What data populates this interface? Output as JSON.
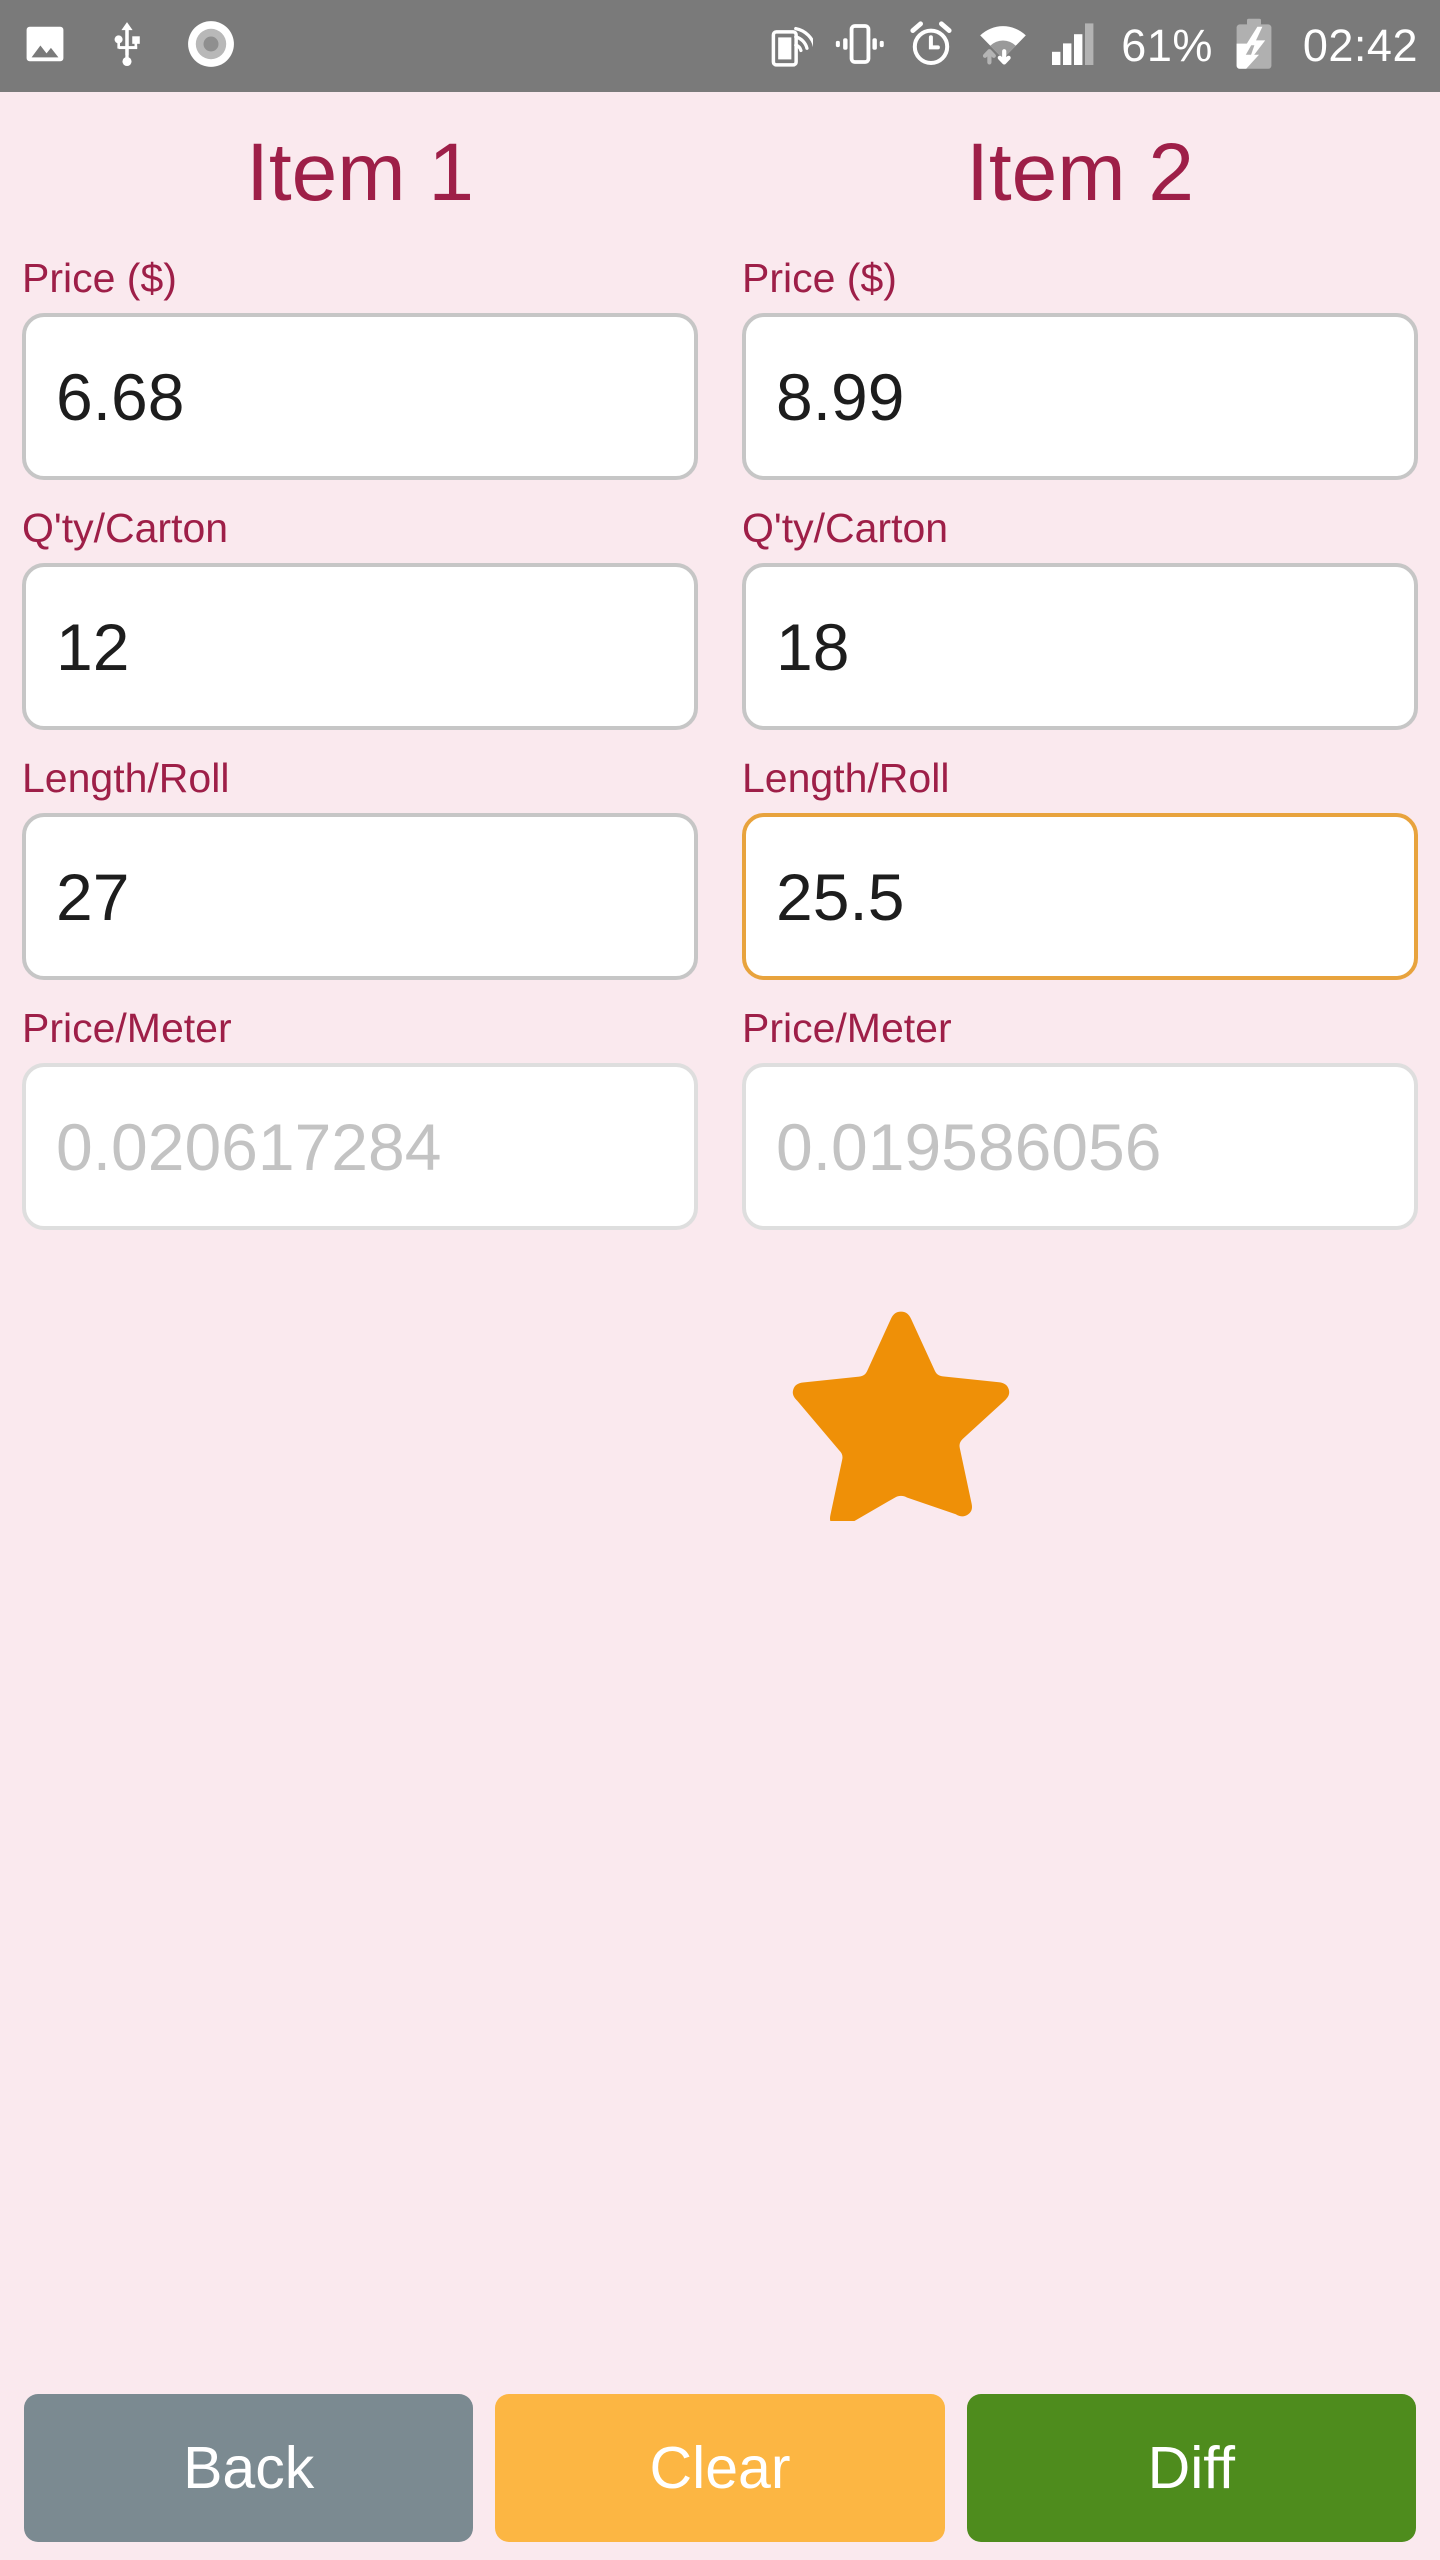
{
  "statusbar": {
    "battery_percent": "61%",
    "time": "02:42",
    "left_icons": [
      "image-icon",
      "usb-icon",
      "record-circle-icon"
    ],
    "right_icons": [
      "cast-screen-icon",
      "vibrate-icon",
      "alarm-icon",
      "wifi-icon",
      "cellular-signal-icon",
      "battery-charging-icon"
    ]
  },
  "theme": {
    "background": "#fae9ee",
    "label_color": "#9e1f48",
    "input_border": "#c6c6c6",
    "input_focus_border": "#e8a33d",
    "readonly_text": "#c3c3c3",
    "star_color": "#ef9007",
    "statusbar_bg": "#7a7a7a"
  },
  "columns": [
    {
      "title": "Item 1",
      "fields": [
        {
          "label": "Price ($)",
          "value": "6.68",
          "state": "normal",
          "name": "price"
        },
        {
          "label": "Q'ty/Carton",
          "value": "12",
          "state": "normal",
          "name": "qty-carton"
        },
        {
          "label": "Length/Roll",
          "value": "27",
          "state": "normal",
          "name": "length-roll"
        },
        {
          "label": "Price/Meter",
          "value": "0.020617284",
          "state": "readonly",
          "name": "price-meter"
        }
      ],
      "starred": false
    },
    {
      "title": "Item 2",
      "fields": [
        {
          "label": "Price ($)",
          "value": "8.99",
          "state": "normal",
          "name": "price"
        },
        {
          "label": "Q'ty/Carton",
          "value": "18",
          "state": "normal",
          "name": "qty-carton"
        },
        {
          "label": "Length/Roll",
          "value": "25.5",
          "state": "focused",
          "name": "length-roll"
        },
        {
          "label": "Price/Meter",
          "value": "0.019586056",
          "state": "readonly",
          "name": "price-meter"
        }
      ],
      "starred": true
    }
  ],
  "buttons": [
    {
      "label": "Back",
      "name": "back-button",
      "color": "#7b8a91"
    },
    {
      "label": "Clear",
      "name": "clear-button",
      "color": "#fcb643"
    },
    {
      "label": "Diff",
      "name": "diff-button",
      "color": "#4e8c1d"
    }
  ]
}
